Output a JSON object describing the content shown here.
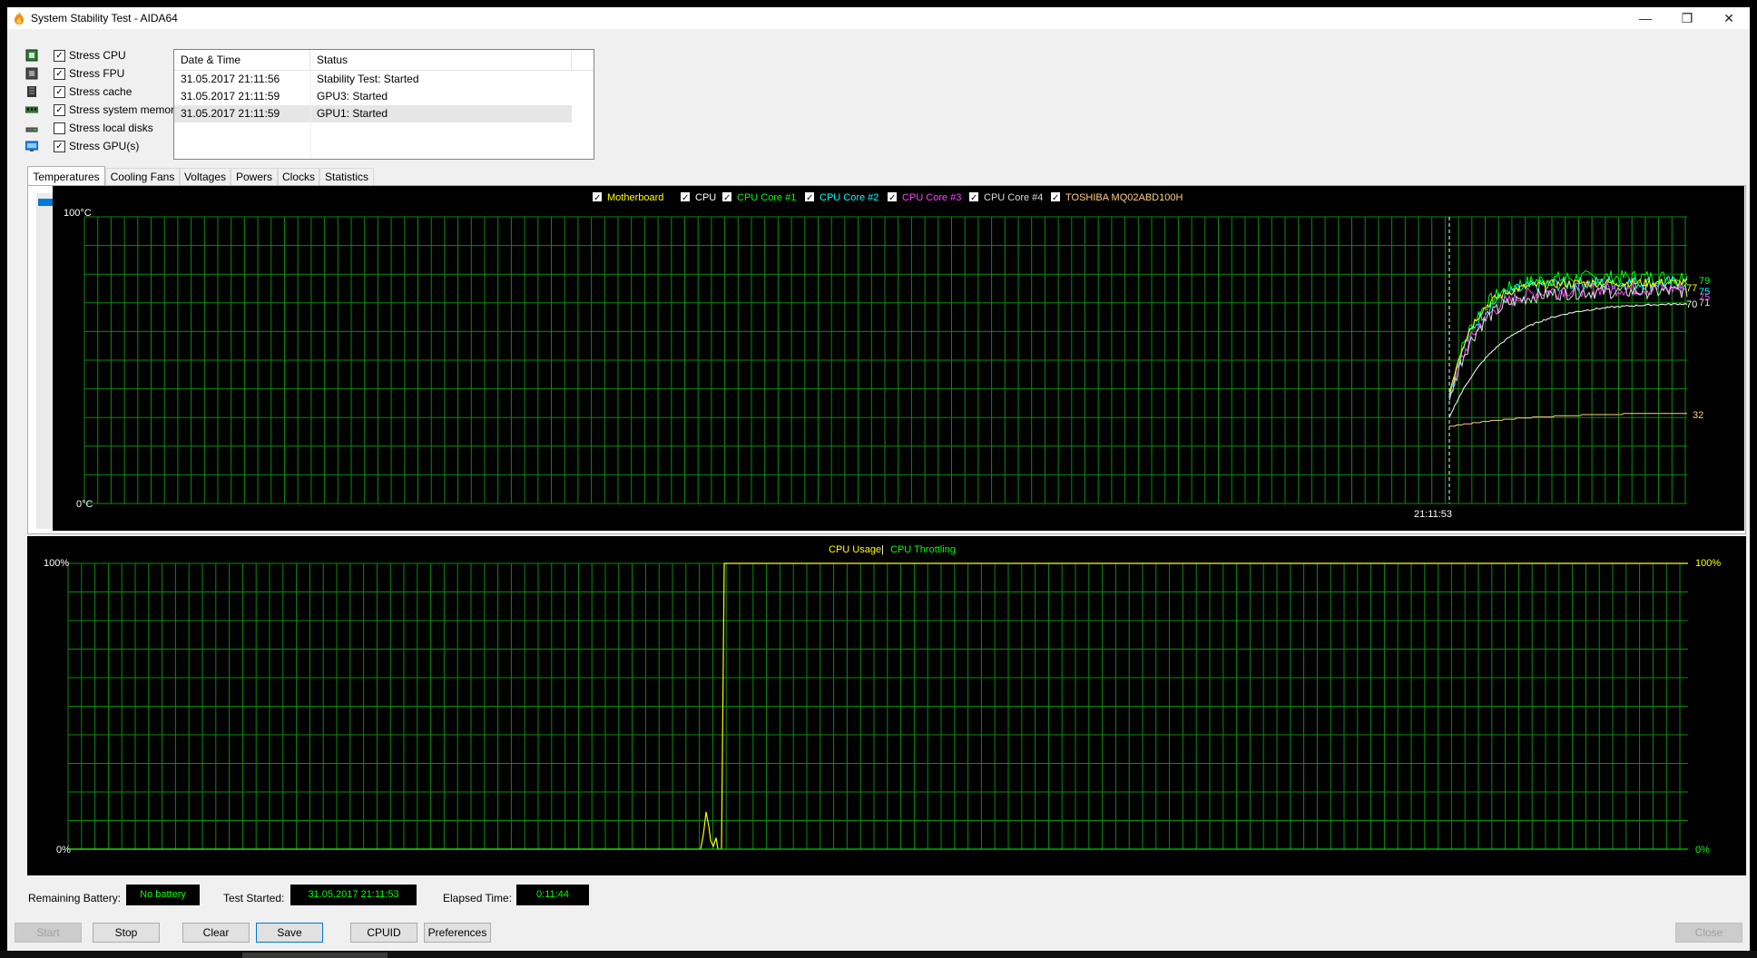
{
  "window": {
    "title": "System Stability Test - AIDA64",
    "controls": {
      "minimize": "—",
      "maximize": "❐",
      "close": "✕"
    }
  },
  "stress_options": [
    {
      "label": "Stress CPU",
      "checked": true,
      "icon": "cpu-icon"
    },
    {
      "label": "Stress FPU",
      "checked": true,
      "icon": "fpu-icon"
    },
    {
      "label": "Stress cache",
      "checked": true,
      "icon": "cache-icon"
    },
    {
      "label": "Stress system memory",
      "checked": true,
      "icon": "memory-icon"
    },
    {
      "label": "Stress local disks",
      "checked": false,
      "icon": "disk-icon"
    },
    {
      "label": "Stress GPU(s)",
      "checked": true,
      "icon": "gpu-icon"
    }
  ],
  "log": {
    "headers": [
      "Date & Time",
      "Status"
    ],
    "rows": [
      {
        "time": "31.05.2017 21:11:56",
        "status": "Stability Test: Started"
      },
      {
        "time": "31.05.2017 21:11:59",
        "status": "GPU3: Started"
      },
      {
        "time": "31.05.2017 21:11:59",
        "status": "GPU1: Started"
      }
    ]
  },
  "tabs": [
    "Temperatures",
    "Cooling Fans",
    "Voltages",
    "Powers",
    "Clocks",
    "Statistics"
  ],
  "active_tab": "Temperatures",
  "temperature_chart": {
    "legend": [
      {
        "label": "Motherboard",
        "color": "#ffff00"
      },
      {
        "label": "CPU",
        "color": "#ffffff"
      },
      {
        "label": "CPU Core #1",
        "color": "#00ff00"
      },
      {
        "label": "CPU Core #2",
        "color": "#00ffff"
      },
      {
        "label": "CPU Core #3",
        "color": "#ff40ff"
      },
      {
        "label": "CPU Core #4",
        "color": "#dcdcdc"
      },
      {
        "label": "TOSHIBA MQ02ABD100H",
        "color": "#ffd080"
      }
    ],
    "y_max_label": "100°C",
    "y_min_label": "0°C",
    "time_marker": "21:11:53",
    "end_values": [
      {
        "text": "79",
        "color": "#00ff00"
      },
      {
        "text": "77",
        "color": "#ffff00"
      },
      {
        "text": "75",
        "color": "#00ffff"
      },
      {
        "text": "75",
        "color": "#ff40ff"
      },
      {
        "text": "70",
        "color": "#ffffff"
      },
      {
        "text": "71",
        "color": "#dcdcdc"
      },
      {
        "text": "32",
        "color": "#ffd080"
      }
    ]
  },
  "cpu_chart": {
    "legend_usage": "CPU Usage",
    "legend_sep": "|",
    "legend_throttling": "CPU Throttling",
    "y_max_left": "100%",
    "y_min_left": "0%",
    "y_max_right": "100%",
    "y_min_right": "0%",
    "colors": {
      "usage": "#ffff00",
      "throttling": "#00ff00"
    }
  },
  "chart_data": [
    {
      "type": "line",
      "title": "",
      "ylim": [
        0,
        100
      ],
      "series": [
        {
          "name": "CPU Core #1",
          "end_value": 79
        },
        {
          "name": "Motherboard",
          "end_value": 77
        },
        {
          "name": "CPU Core #2",
          "end_value": 75
        },
        {
          "name": "CPU Core #3",
          "end_value": 75
        },
        {
          "name": "CPU",
          "end_value": 70
        },
        {
          "name": "CPU Core #4",
          "end_value": 71
        },
        {
          "name": "TOSHIBA MQ02ABD100H",
          "end_value": 32
        }
      ]
    },
    {
      "type": "line",
      "title": "",
      "ylim": [
        0,
        100
      ],
      "series": [
        {
          "name": "CPU Usage",
          "end_value": 100
        },
        {
          "name": "CPU Throttling",
          "end_value": 0
        }
      ]
    }
  ],
  "status": {
    "battery_label": "Remaining Battery:",
    "battery_value": "No battery",
    "started_label": "Test Started:",
    "started_value": "31.05.2017 21:11:53",
    "elapsed_label": "Elapsed Time:",
    "elapsed_value": "0:11:44"
  },
  "buttons": {
    "start": "Start",
    "stop": "Stop",
    "clear": "Clear",
    "save": "Save",
    "cpuid": "CPUID",
    "preferences": "Preferences",
    "close": "Close"
  }
}
